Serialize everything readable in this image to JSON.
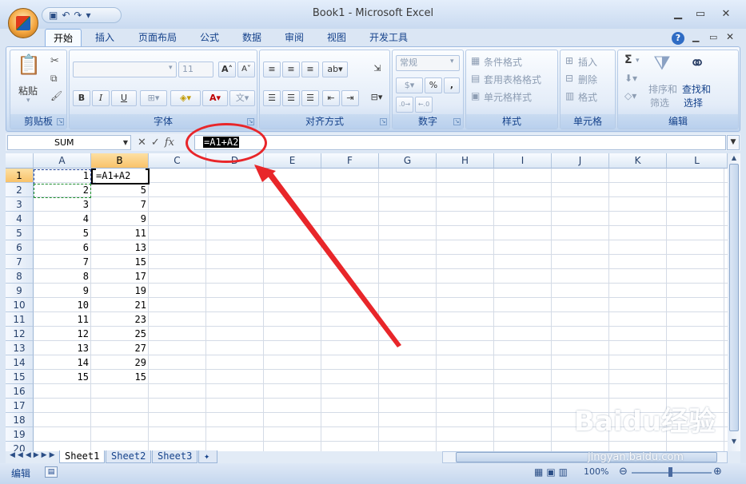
{
  "window": {
    "title": "Book1 - Microsoft Excel"
  },
  "ribbon_tabs": [
    "开始",
    "插入",
    "页面布局",
    "公式",
    "数据",
    "审阅",
    "视图",
    "开发工具"
  ],
  "groups": {
    "clipboard": {
      "label": "剪贴板",
      "paste": "粘贴"
    },
    "font": {
      "label": "字体",
      "font_name": "",
      "font_size": "11",
      "bold": "B",
      "italic": "I",
      "underline": "U"
    },
    "alignment": {
      "label": "对齐方式"
    },
    "number": {
      "label": "数字",
      "format": "常规",
      "percent": "%",
      "comma": ","
    },
    "styles": {
      "label": "样式",
      "conditional": "条件格式",
      "table": "套用表格格式",
      "cell_styles": "单元格样式"
    },
    "cells": {
      "label": "单元格",
      "insert": "插入",
      "delete": "删除",
      "format": "格式"
    },
    "editing": {
      "label": "编辑",
      "sum": "Σ",
      "sort_line1": "排序和",
      "sort_line2": "筛选",
      "find_line1": "查找和",
      "find_line2": "选择"
    }
  },
  "formula_bar": {
    "name_box": "SUM",
    "formula": "=A1+A2",
    "fx": "fx"
  },
  "columns": [
    "A",
    "B",
    "C",
    "D",
    "E",
    "F",
    "G",
    "H",
    "I",
    "J",
    "K",
    "L"
  ],
  "rows": [
    "1",
    "2",
    "3",
    "4",
    "5",
    "6",
    "7",
    "8",
    "9",
    "10",
    "11",
    "12",
    "13",
    "14",
    "15",
    "16",
    "17",
    "18",
    "19",
    "20"
  ],
  "cells": {
    "A": [
      "1",
      "2",
      "3",
      "4",
      "5",
      "6",
      "7",
      "8",
      "9",
      "10",
      "11",
      "12",
      "13",
      "14",
      "15"
    ],
    "B": [
      "=A1+A2",
      "5",
      "7",
      "9",
      "11",
      "13",
      "15",
      "17",
      "19",
      "21",
      "23",
      "25",
      "27",
      "29",
      "15"
    ]
  },
  "sheet_tabs": [
    "Sheet1",
    "Sheet2",
    "Sheet3"
  ],
  "status": {
    "mode": "编辑",
    "zoom": "100%"
  },
  "watermark": {
    "main": "Baidu经验",
    "sub": "jingyan.baidu.com"
  },
  "colors": {
    "accent": "#15428b",
    "annotation": "#e8262a",
    "active_header": "#f8c26a"
  }
}
